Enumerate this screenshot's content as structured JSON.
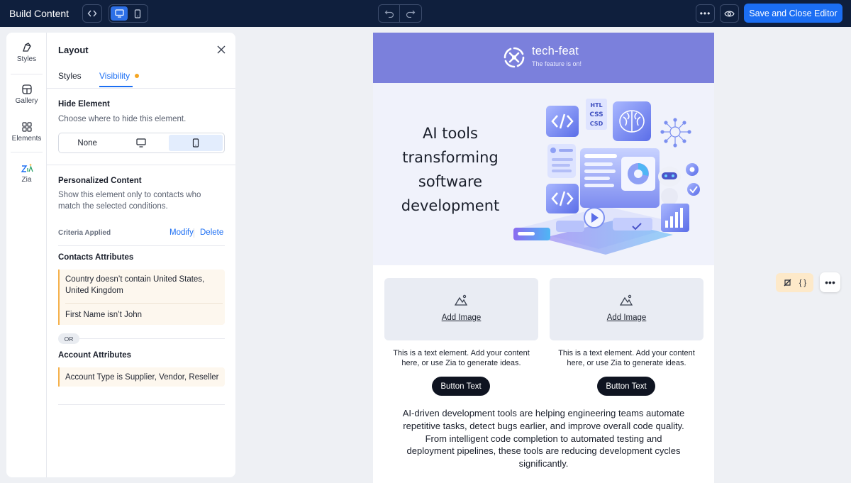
{
  "app": {
    "title": "Build Content"
  },
  "toolbar": {
    "save_label": "Save and Close Editor"
  },
  "rail": {
    "items": [
      {
        "label": "Styles",
        "icon": "brush-icon"
      },
      {
        "label": "Gallery",
        "icon": "gallery-icon"
      },
      {
        "label": "Elements",
        "icon": "grid-icon"
      },
      {
        "label": "Zia",
        "icon": "zia-icon"
      }
    ]
  },
  "panel": {
    "title": "Layout",
    "tabs": [
      {
        "label": "Styles",
        "active": false
      },
      {
        "label": "Visibility",
        "active": true
      }
    ],
    "hide_element": {
      "title": "Hide Element",
      "desc": "Choose where to hide this element.",
      "options": [
        "None",
        "desktop-icon",
        "mobile-icon"
      ],
      "selected": "mobile-icon"
    },
    "personalized": {
      "title": "Personalized Content",
      "desc": "Show this element only to contacts who match the selected conditions.",
      "criteria_label": "Criteria Applied",
      "modify": "Modify",
      "delete": "Delete",
      "contacts_title": "Contacts Attributes",
      "contact_conditions": [
        "Country doesn’t contain United States, United Kingdom",
        "First Name isn’t John"
      ],
      "or_label": "OR",
      "account_title": "Account Attributes",
      "account_conditions": [
        "Account Type is Supplier, Vendor, Reseller"
      ]
    }
  },
  "email": {
    "brand": {
      "name": "tech-feat",
      "tagline": "The feature is on!"
    },
    "hero_title": "AI tools transforming software development",
    "columns": [
      {
        "add_image": "Add Image",
        "text": "This is a text element. Add your content here, or use Zia to generate ideas.",
        "button": "Button Text"
      },
      {
        "add_image": "Add Image",
        "text": "This is a text element. Add your content here, or use Zia to generate ideas.",
        "button": "Button Text"
      }
    ],
    "body": "AI-driven development tools are helping engineering teams automate repetitive tasks, detect bugs earlier, and improve overall code quality. From intelligent code completion to automated testing and deployment pipelines, these tools are reducing development cycles significantly.",
    "hero_art_labels": [
      "HTL",
      "CSS",
      "CSD"
    ]
  },
  "float_tools": {
    "code_label": "{ }",
    "more_label": "•••"
  },
  "colors": {
    "topbar": "#0f1f3d",
    "accent": "#1b6ef3",
    "header": "#7b80dc",
    "condition": "#f5b14c"
  }
}
